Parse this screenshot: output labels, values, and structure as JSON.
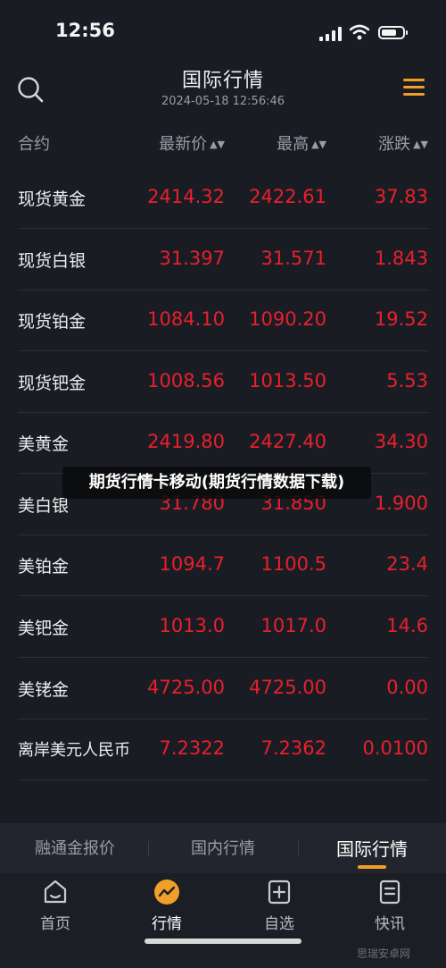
{
  "status": {
    "time": "12:56"
  },
  "header": {
    "title": "国际行情",
    "subtitle": "2024-05-18 12:56:46",
    "search_icon": "search-icon",
    "menu_icon": "hamburger-menu-icon",
    "accent": "#f0a029"
  },
  "columns": {
    "contract": "合约",
    "latest": "最新价",
    "high": "最高",
    "change": "涨跌",
    "sort_icon": "sort-icon"
  },
  "table": {
    "price_color": "#e8202c",
    "rows": [
      {
        "name": "现货黄金",
        "latest": "2414.32",
        "high": "2422.61",
        "change": "37.83"
      },
      {
        "name": "现货白银",
        "latest": "31.397",
        "high": "31.571",
        "change": "1.843"
      },
      {
        "name": "现货铂金",
        "latest": "1084.10",
        "high": "1090.20",
        "change": "19.52"
      },
      {
        "name": "现货钯金",
        "latest": "1008.56",
        "high": "1013.50",
        "change": "5.53"
      },
      {
        "name": "美黄金",
        "latest": "2419.80",
        "high": "2427.40",
        "change": "34.30"
      },
      {
        "name": "美白银",
        "latest": "31.780",
        "high": "31.850",
        "change": "1.900"
      },
      {
        "name": "美铂金",
        "latest": "1094.7",
        "high": "1100.5",
        "change": "23.4"
      },
      {
        "name": "美钯金",
        "latest": "1013.0",
        "high": "1017.0",
        "change": "14.6"
      },
      {
        "name": "美铑金",
        "latest": "4725.00",
        "high": "4725.00",
        "change": "0.00"
      },
      {
        "name": "离岸美元人民币",
        "latest": "7.2322",
        "high": "7.2362",
        "change": "0.0100"
      }
    ]
  },
  "banner": {
    "text": "期货行情卡移动(期货行情数据下载)"
  },
  "segments": [
    {
      "label": "融通金报价"
    },
    {
      "label": "国内行情"
    },
    {
      "label": "国际行情",
      "active": true
    }
  ],
  "tabbar": [
    {
      "label": "首页",
      "icon": "home-icon"
    },
    {
      "label": "行情",
      "icon": "trend-chart-icon",
      "active": true
    },
    {
      "label": "自选",
      "icon": "add-watchlist-icon"
    },
    {
      "label": "快讯",
      "icon": "news-doc-icon"
    }
  ],
  "watermark": {
    "text": "思瑞安卓网"
  }
}
